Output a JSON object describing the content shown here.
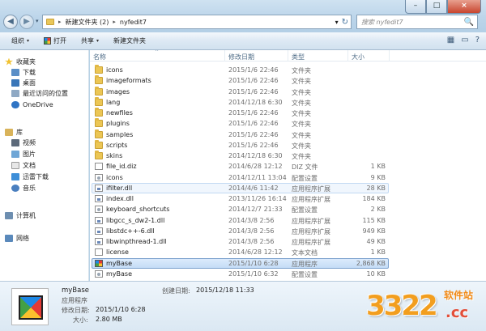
{
  "window": {
    "minimize": "–",
    "maximize": "□",
    "close": "×"
  },
  "address": {
    "back_icon": "◀",
    "forward_icon": "▶",
    "dropdown": "▾",
    "crumb_sep": "▸",
    "crumbs": [
      "新建文件夹 (2)",
      "nyfedit7"
    ],
    "dropdown_icon": "▾",
    "refresh_icon": "↻"
  },
  "search": {
    "placeholder": "搜索 nyfedit7",
    "icon": "🔍"
  },
  "toolbar": {
    "organize": "组织",
    "open": "打开",
    "share": "共享",
    "new_folder": "新建文件夹",
    "caret": "▾",
    "view_icon": "▦",
    "pane_icon": "▭",
    "help_icon": "?"
  },
  "sidebar": {
    "favorites": "收藏夹",
    "downloads": "下载",
    "desktop": "桌面",
    "recent": "最近访问的位置",
    "onedrive": "OneDrive",
    "libraries": "库",
    "videos": "视频",
    "pictures": "图片",
    "documents": "文档",
    "xunlei": "迅雷下载",
    "music": "音乐",
    "computer": "计算机",
    "network": "网络"
  },
  "columns": {
    "name": "名称",
    "date": "修改日期",
    "type": "类型",
    "size": "大小",
    "sort_indicator": "^"
  },
  "files": [
    {
      "name": "icons",
      "date": "2015/1/6 22:46",
      "type": "文件夹",
      "size": "",
      "kind": "folder"
    },
    {
      "name": "imageformats",
      "date": "2015/1/6 22:46",
      "type": "文件夹",
      "size": "",
      "kind": "folder"
    },
    {
      "name": "images",
      "date": "2015/1/6 22:46",
      "type": "文件夹",
      "size": "",
      "kind": "folder"
    },
    {
      "name": "lang",
      "date": "2014/12/18 6:30",
      "type": "文件夹",
      "size": "",
      "kind": "folder"
    },
    {
      "name": "newfiles",
      "date": "2015/1/6 22:46",
      "type": "文件夹",
      "size": "",
      "kind": "folder"
    },
    {
      "name": "plugins",
      "date": "2015/1/6 22:46",
      "type": "文件夹",
      "size": "",
      "kind": "folder"
    },
    {
      "name": "samples",
      "date": "2015/1/6 22:46",
      "type": "文件夹",
      "size": "",
      "kind": "folder"
    },
    {
      "name": "scripts",
      "date": "2015/1/6 22:46",
      "type": "文件夹",
      "size": "",
      "kind": "folder"
    },
    {
      "name": "skins",
      "date": "2014/12/18 6:30",
      "type": "文件夹",
      "size": "",
      "kind": "folder"
    },
    {
      "name": "file_id.diz",
      "date": "2014/6/28 12:12",
      "type": "DIZ 文件",
      "size": "1 KB",
      "kind": "doc"
    },
    {
      "name": "icons",
      "date": "2014/12/11 13:04",
      "type": "配置设置",
      "size": "9 KB",
      "kind": "ini"
    },
    {
      "name": "ifilter.dll",
      "date": "2014/4/6 11:42",
      "type": "应用程序扩展",
      "size": "28 KB",
      "kind": "dll"
    },
    {
      "name": "index.dll",
      "date": "2013/11/26 16:14",
      "type": "应用程序扩展",
      "size": "184 KB",
      "kind": "dll"
    },
    {
      "name": "keyboard_shortcuts",
      "date": "2014/12/7 21:33",
      "type": "配置设置",
      "size": "2 KB",
      "kind": "ini"
    },
    {
      "name": "libgcc_s_dw2-1.dll",
      "date": "2014/3/8 2:56",
      "type": "应用程序扩展",
      "size": "115 KB",
      "kind": "dll"
    },
    {
      "name": "libstdc++-6.dll",
      "date": "2014/3/8 2:56",
      "type": "应用程序扩展",
      "size": "949 KB",
      "kind": "dll"
    },
    {
      "name": "libwinpthread-1.dll",
      "date": "2014/3/8 2:56",
      "type": "应用程序扩展",
      "size": "49 KB",
      "kind": "dll"
    },
    {
      "name": "license",
      "date": "2014/6/28 12:12",
      "type": "文本文档",
      "size": "1 KB",
      "kind": "doc"
    },
    {
      "name": "myBase",
      "date": "2015/1/10 6:28",
      "type": "应用程序",
      "size": "2,868 KB",
      "kind": "app"
    },
    {
      "name": "myBase",
      "date": "2015/1/10 6:32",
      "type": "配置设置",
      "size": "10 KB",
      "kind": "ini"
    }
  ],
  "details": {
    "name": "myBase",
    "type": "应用程序",
    "modified_label": "修改日期:",
    "modified": "2015/1/10 6:28",
    "size_label": "大小:",
    "size": "2.80 MB",
    "created_label": "创建日期:",
    "created": "2015/12/18 11:33"
  },
  "watermark": {
    "number": "3322",
    "site": "软件站",
    "domain": ".cc"
  }
}
